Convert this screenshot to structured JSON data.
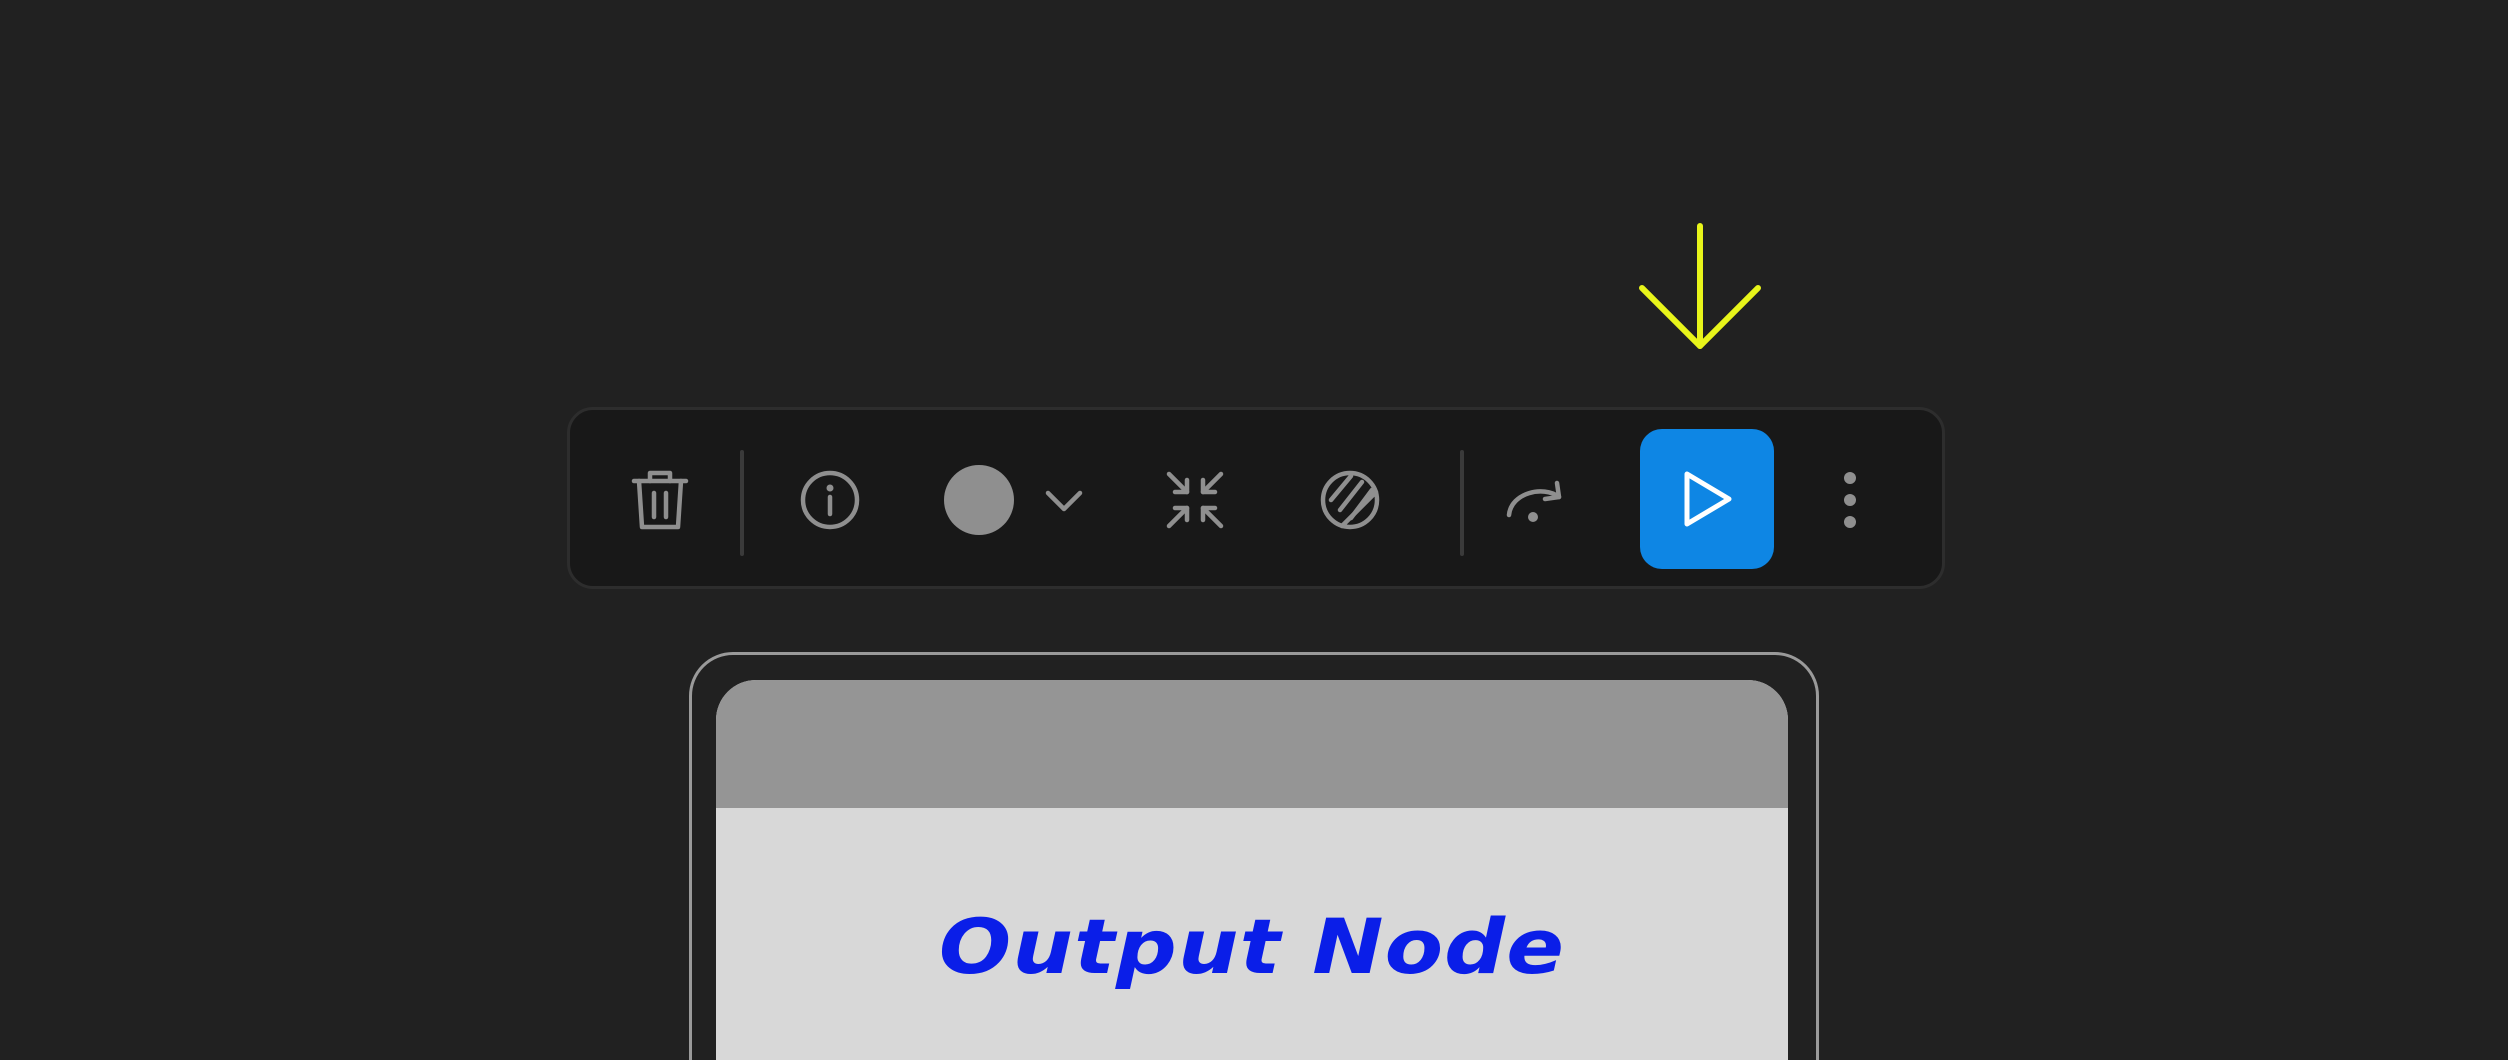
{
  "toolbar": {
    "items": [
      {
        "name": "delete",
        "icon": "trash-icon"
      },
      {
        "name": "info",
        "icon": "info-icon"
      },
      {
        "name": "color",
        "icon": "color-swatch-icon",
        "selected_color": "#8f8f8f"
      },
      {
        "name": "collapse",
        "icon": "collapse-icon"
      },
      {
        "name": "bypass",
        "icon": "bypass-icon"
      },
      {
        "name": "skip",
        "icon": "redo-arrow-icon"
      },
      {
        "name": "run",
        "icon": "play-icon",
        "accent": "#0e86e4"
      },
      {
        "name": "more",
        "icon": "more-vertical-icon"
      }
    ]
  },
  "annotation": {
    "icon": "arrow-down-icon",
    "color": "#e8f51a"
  },
  "node": {
    "title": "Output Node",
    "title_color": "#0a1ee8"
  }
}
